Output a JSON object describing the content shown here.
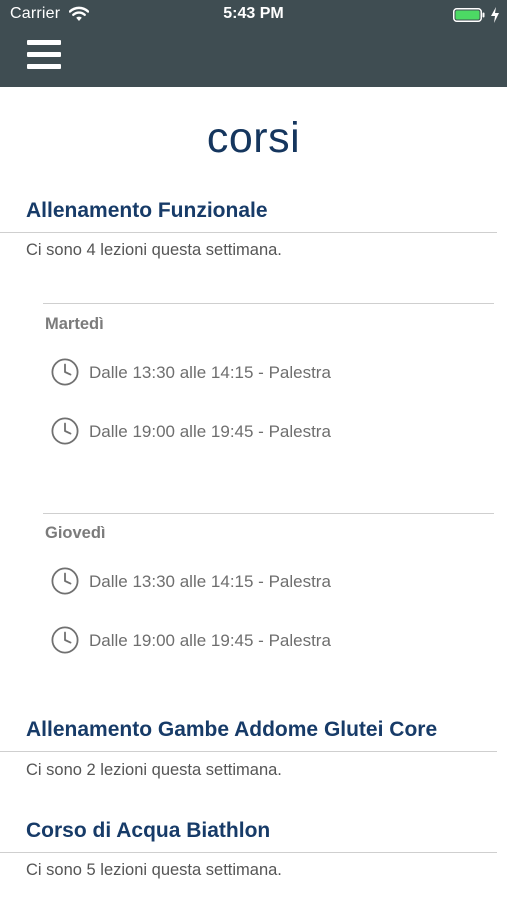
{
  "status_bar": {
    "carrier": "Carrier",
    "time": "5:43 PM"
  },
  "nav": {
    "menu_icon": "hamburger-menu-icon",
    "bar_color": "#3f4d52"
  },
  "page": {
    "title": "corsi",
    "title_color": "#15365e"
  },
  "courses": [
    {
      "title": "Allenamento Funzionale",
      "subtitle": "Ci sono 4 lezioni questa settimana.",
      "days": [
        {
          "day": "Martedì",
          "lessons": [
            "Dalle 13:30 alle 14:15 - Palestra",
            "Dalle 19:00 alle 19:45 - Palestra"
          ]
        },
        {
          "day": "Giovedì",
          "lessons": [
            "Dalle 13:30 alle 14:15 - Palestra",
            "Dalle 19:00 alle 19:45 - Palestra"
          ]
        }
      ]
    },
    {
      "title": "Allenamento Gambe Addome Glutei Core",
      "subtitle": "Ci sono 2 lezioni questa settimana."
    },
    {
      "title": "Corso di Acqua Biathlon",
      "subtitle": "Ci sono 5 lezioni questa settimana."
    }
  ],
  "icons": {
    "lesson": "clock-icon",
    "battery": "battery-icon",
    "wifi": "wifi-icon",
    "charging": "charging-bolt-icon"
  }
}
